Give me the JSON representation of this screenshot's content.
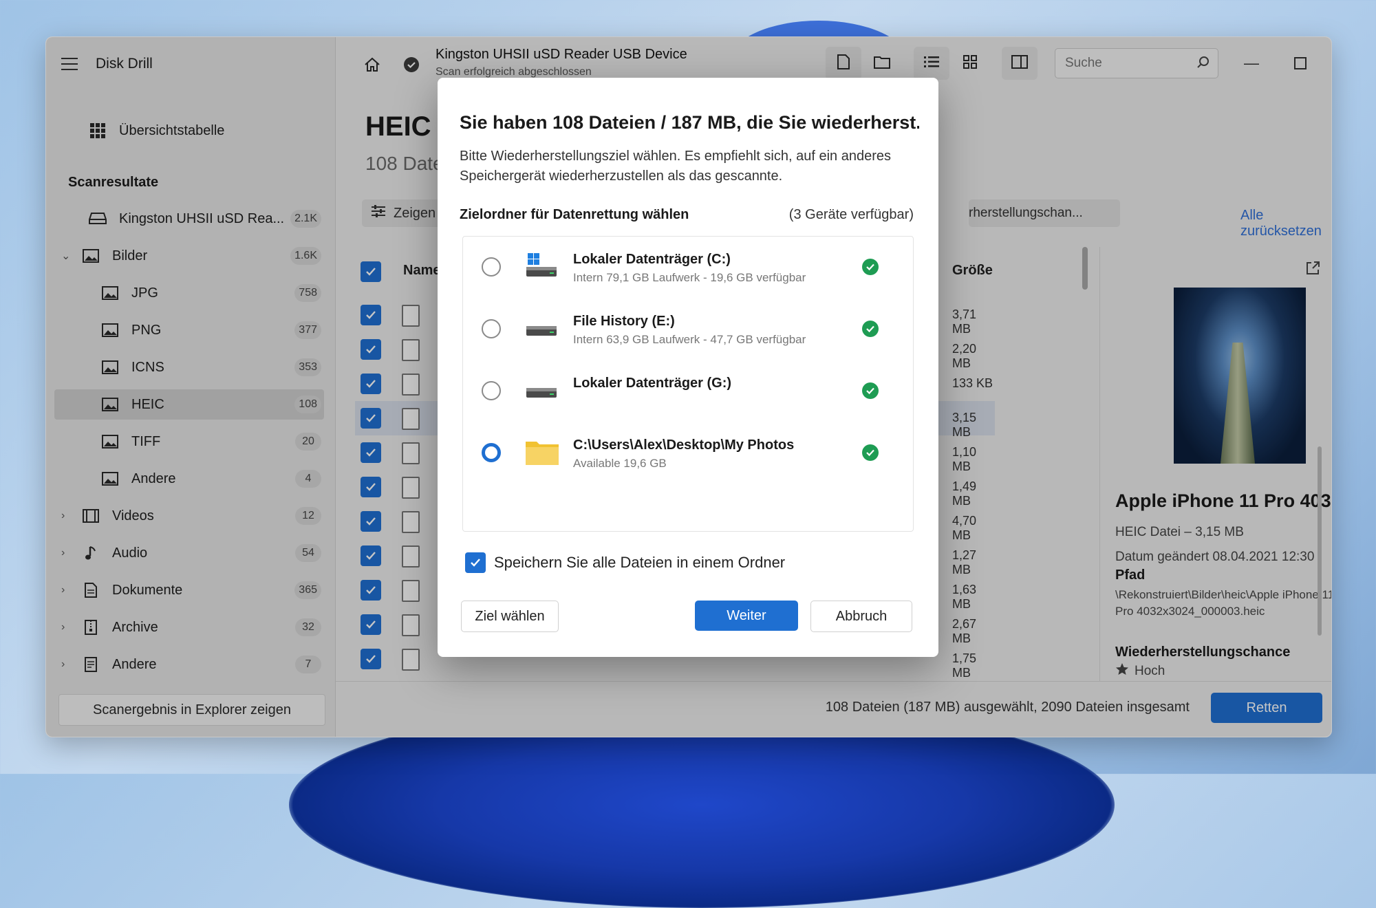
{
  "app": {
    "title": "Disk Drill"
  },
  "sidebar": {
    "overview": {
      "label": "Übersichtstabelle"
    },
    "section": "Scanresultate",
    "device": {
      "label": "Kingston UHSII uSD Rea...",
      "count": "2.1K"
    },
    "groups": [
      {
        "label": "Bilder",
        "count": "1.6K",
        "expanded": true,
        "icon": "image-icon",
        "children": [
          {
            "label": "JPG",
            "count": "758"
          },
          {
            "label": "PNG",
            "count": "377"
          },
          {
            "label": "ICNS",
            "count": "353"
          },
          {
            "label": "HEIC",
            "count": "108",
            "active": true
          },
          {
            "label": "TIFF",
            "count": "20"
          },
          {
            "label": "Andere",
            "count": "4"
          }
        ]
      },
      {
        "label": "Videos",
        "count": "12",
        "icon": "film-icon"
      },
      {
        "label": "Audio",
        "count": "54",
        "icon": "music-note-icon"
      },
      {
        "label": "Dokumente",
        "count": "365",
        "icon": "document-icon"
      },
      {
        "label": "Archive",
        "count": "32",
        "icon": "archive-icon"
      },
      {
        "label": "Andere",
        "count": "7",
        "icon": "other-file-icon"
      }
    ],
    "footer_button": "Scanergebnis in Explorer zeigen"
  },
  "topbar": {
    "device_title": "Kingston UHSII uSD Reader USB Device",
    "device_status": "Scan erfolgreich abgeschlossen",
    "search_placeholder": "Suche"
  },
  "main": {
    "title": "HEIC",
    "subtitle": "108 Date",
    "filter_label": "Zeigen",
    "recovery_chip": "rherstellungschan...",
    "reset_label": "Alle zurücksetzen",
    "columns": {
      "name": "Name",
      "size": "Größe"
    },
    "rows": [
      {
        "size": "3,71 MB"
      },
      {
        "size": "2,20 MB"
      },
      {
        "size": "133 KB"
      },
      {
        "size": "3,15 MB",
        "selected": true
      },
      {
        "size": "1,10 MB"
      },
      {
        "size": "1,49 MB"
      },
      {
        "size": "4,70 MB"
      },
      {
        "size": "1,27 MB"
      },
      {
        "size": "1,63 MB"
      },
      {
        "size": "2,67 MB"
      },
      {
        "size": "1,75 MB"
      }
    ]
  },
  "preview": {
    "title": "Apple iPhone 11 Pro 403...",
    "type_size": "HEIC Datei – 3,15 MB",
    "date": "Datum geändert 08.04.2021 12:30",
    "path_label": "Pfad",
    "path": "\\Rekonstruiert\\Bilder\\heic\\Apple iPhone 11 Pro 4032x3024_000003.heic",
    "chance_label": "Wiederherstellungschance",
    "chance_value": "Hoch"
  },
  "statusbar": {
    "text": "108 Dateien (187 MB) ausgewählt, 2090 Dateien insgesamt",
    "recover_button": "Retten"
  },
  "dialog": {
    "title": "Sie haben 108 Dateien / 187 MB, die Sie wiederherst...",
    "description": "Bitte Wiederherstellungsziel wählen. Es empfiehlt sich, auf ein anderes Speichergerät wiederherzustellen als das gescannte.",
    "section_label": "Zielordner für Datenrettung wählen",
    "available": "(3 Geräte verfügbar)",
    "destinations": [
      {
        "name": "Lokaler Datenträger (C:)",
        "detail": "Intern 79,1 GB Laufwerk - 19,6 GB verfügbar",
        "icon": "windows-drive-icon",
        "selected": false
      },
      {
        "name": "File History (E:)",
        "detail": "Intern 63,9 GB Laufwerk - 47,7 GB verfügbar",
        "icon": "drive-icon",
        "selected": false
      },
      {
        "name": "Lokaler Datenträger (G:)",
        "detail": "",
        "icon": "drive-icon",
        "selected": false
      },
      {
        "name": "C:\\Users\\Alex\\Desktop\\My Photos",
        "detail": "Available 19,6 GB",
        "icon": "folder-icon",
        "selected": true
      }
    ],
    "save_all_label": "Speichern Sie alle Dateien in einem Ordner",
    "save_all_checked": true,
    "choose_button": "Ziel wählen",
    "next_button": "Weiter",
    "cancel_button": "Abbruch"
  },
  "colors": {
    "accent": "#1f6fd1",
    "success": "#1e9c53"
  }
}
